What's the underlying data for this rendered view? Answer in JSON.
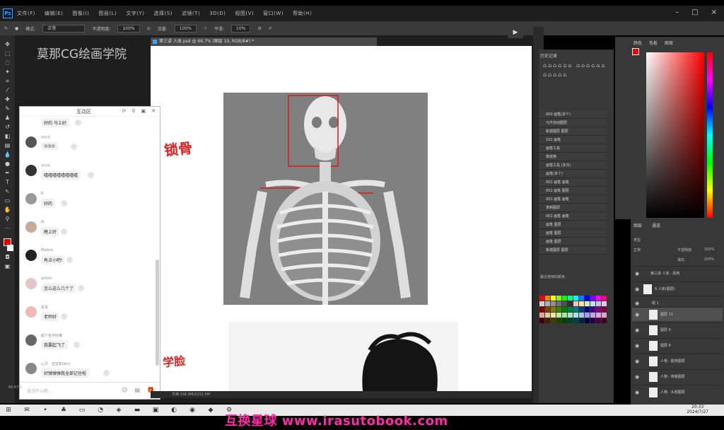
{
  "app": {
    "logo": "Ps",
    "menu": [
      "文件(F)",
      "编辑(E)",
      "图像(I)",
      "图层(L)",
      "文字(Y)",
      "选择(S)",
      "滤镜(T)",
      "3D(D)",
      "视图(V)",
      "窗口(W)",
      "帮助(H)"
    ],
    "window_controls": [
      "–",
      "□",
      "×"
    ]
  },
  "options": {
    "mode_label": "模式:",
    "mode_value": "正常",
    "opacity_label": "不透明度:",
    "opacity_value": "100%",
    "flow_label": "流量:",
    "flow_value": "100%",
    "smooth_label": "平滑:",
    "smooth_value": "10%"
  },
  "workspace": {
    "watermark": "莫那CG绘画学院"
  },
  "document": {
    "tab_title": "第三讲 人体.psd @ 66.7% (图层 10, RGB/8#) *",
    "annot_top": "锁骨",
    "annot_bottom": "学脸"
  },
  "chat": {
    "title": "互动区",
    "controls": [
      "⟳",
      "⚲",
      "▣",
      "✕"
    ],
    "messages": [
      {
        "sender": "",
        "text": "好的 马上好"
      },
      {
        "sender": "◎◎◎",
        "text": "是的是的"
      },
      {
        "sender": "◎◎◎",
        "text": "嘻嘻嘻嘻嘻嘻嘻嘻"
      },
      {
        "sender": "R",
        "text": "好的"
      },
      {
        "sender": "Ai",
        "text": "晚上好"
      },
      {
        "sender": "Melisin",
        "text": "有点小吧!"
      },
      {
        "sender": "ahhhh",
        "text": "怎么这么几个了"
      },
      {
        "sender": "青青",
        "text": "老师好"
      },
      {
        "sender": "起个名字好难",
        "text": "我要起飞了"
      },
      {
        "sender": "心灵 · 宝宝知(ibn)",
        "text": "好弹弹弹我全部记住啦"
      }
    ],
    "input_placeholder": "说点什么吧...",
    "input_icons": [
      "☺",
      "▤",
      "🎁"
    ]
  },
  "status": {
    "zoom": "66.67%",
    "doc_size": "文档:156.8M/2231.5M"
  },
  "history": {
    "title": "历史记录",
    "items": [
      "000 画笔(多个)",
      "元件自动图层",
      "新建图层 图层",
      "102 画笔",
      "画笔工具",
      "橡皮擦",
      "画笔工具 (多次)",
      "画笔(多个)",
      "002 画笔 画笔",
      "002 画笔 图层",
      "002 画笔 画笔",
      "复制图层",
      "002 画笔 画笔",
      "画笔 图层",
      "画笔 图层",
      "画笔 图层",
      "新建图层 图层"
    ],
    "swatches_label": "最近使用的颜色"
  },
  "color_panel": {
    "tabs": [
      "颜色",
      "色板",
      "图案"
    ],
    "fg": "#e00000"
  },
  "layers_panel": {
    "tabs": [
      "图层",
      "通道"
    ],
    "kind": "类型",
    "blend": "正常",
    "opacity_label": "不透明度:",
    "opacity": "100%",
    "fill_label": "填充:",
    "fill": "100%",
    "rows": [
      {
        "name": "第三讲 人体 · 肌肉",
        "selected": false
      },
      {
        "name": "6 人体(图层)",
        "selected": false
      },
      {
        "name": "组 1",
        "selected": false
      },
      {
        "name": "图层 11",
        "selected": true
      },
      {
        "name": "图层 9",
        "selected": false
      },
      {
        "name": "图层 8",
        "selected": false
      },
      {
        "name": "人物 · 肌肉图层",
        "selected": false
      },
      {
        "name": "人物 · 骨骼图层",
        "selected": false
      },
      {
        "name": "人物 · 头部图层",
        "selected": false
      }
    ]
  },
  "taskbar": {
    "time": "20:33",
    "date": "2024/7/27"
  },
  "overlay": {
    "bottom_watermark": "互换星球 www.irasutobook.com"
  }
}
